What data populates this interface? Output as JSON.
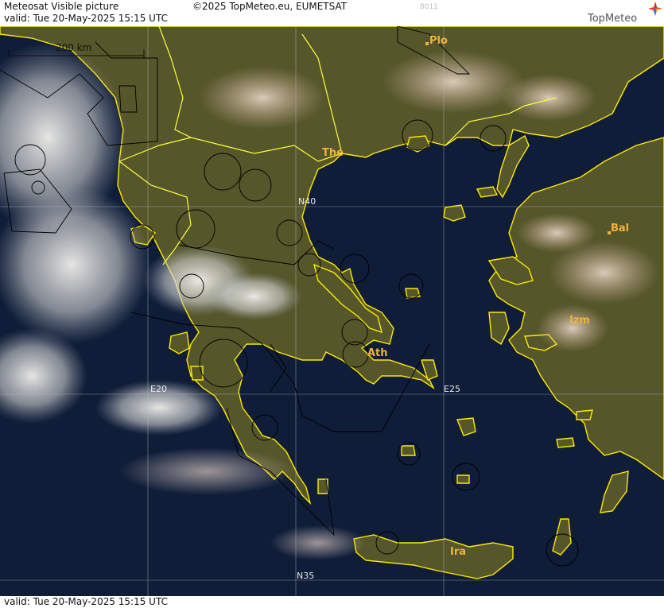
{
  "header": {
    "title": "Meteosat Visible picture",
    "valid": "valid:  Tue  20-May-2025  15:15 UTC",
    "credit": "©2025 TopMeteo.eu, EUMETSAT",
    "code": "8011",
    "logo": "TopMeteo"
  },
  "footer": {
    "valid": "valid:  Tue  20-May-2025  15:15 UTC"
  },
  "map": {
    "scale_label": "200 km",
    "grid_labels": {
      "n40": "N40",
      "n35": "N35",
      "e20": "E20",
      "e25": "E25"
    },
    "cities": [
      {
        "label": "Plo"
      },
      {
        "label": "The"
      },
      {
        "label": "Bal"
      },
      {
        "label": "Izm"
      },
      {
        "label": "Ath"
      },
      {
        "label": "Ira"
      }
    ],
    "colors": {
      "sea": "#0f1d38",
      "land": "#55562a",
      "coast": "#ffea00",
      "border": "#ffff3c",
      "grid": "#b8bcc8",
      "city_label": "#f2b33a",
      "outline": "#000000"
    }
  }
}
